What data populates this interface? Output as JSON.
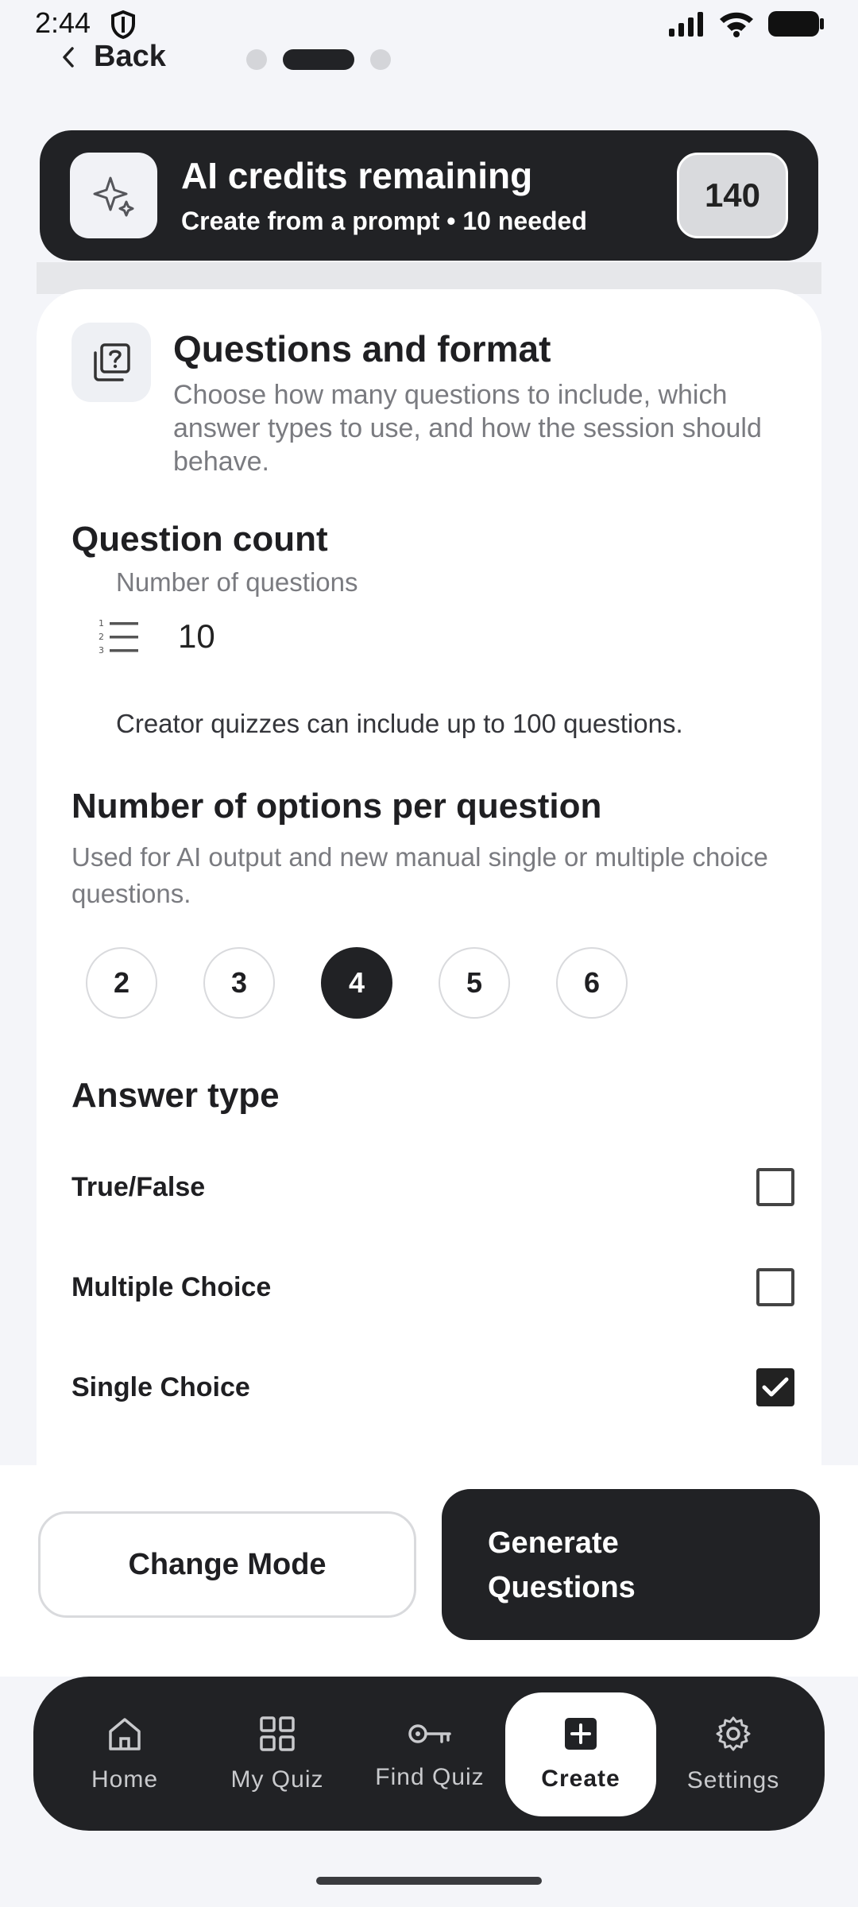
{
  "status_bar": {
    "time": "2:44"
  },
  "header": {
    "back_label": "Back"
  },
  "credits": {
    "title": "AI credits remaining",
    "subtitle": "Create from a prompt • 10 needed",
    "count": "140",
    "icon": "sparkles-icon"
  },
  "section": {
    "icon": "quiz-icon",
    "title": "Questions and format",
    "description": "Choose how many questions to include, which answer types to use, and how the session should behave."
  },
  "question_count": {
    "heading": "Question count",
    "field_label": "Number of questions",
    "value": "10",
    "helper": "Creator quizzes can include up to 100 questions."
  },
  "options_per_question": {
    "heading": "Number of options per question",
    "description": "Used for AI output and new manual single or multiple choice questions.",
    "options": [
      "2",
      "3",
      "4",
      "5",
      "6"
    ],
    "selected": "4"
  },
  "answer_type": {
    "heading": "Answer type",
    "items": [
      {
        "label": "True/False",
        "checked": false
      },
      {
        "label": "Multiple Choice",
        "checked": false
      },
      {
        "label": "Single Choice",
        "checked": true
      }
    ]
  },
  "actions": {
    "change_mode": "Change Mode",
    "generate_line1": "Generate",
    "generate_line2": "Questions"
  },
  "nav": {
    "items": [
      {
        "label": "Home",
        "icon": "home-icon"
      },
      {
        "label": "My Quiz",
        "icon": "grid-icon"
      },
      {
        "label": "Find Quiz",
        "icon": "key-icon"
      },
      {
        "label": "Create",
        "icon": "plus-box-icon",
        "active": true
      },
      {
        "label": "Settings",
        "icon": "gear-icon"
      }
    ]
  },
  "colors": {
    "dark": "#212225",
    "background": "#f4f5f9",
    "muted_text": "#7a7b80"
  }
}
